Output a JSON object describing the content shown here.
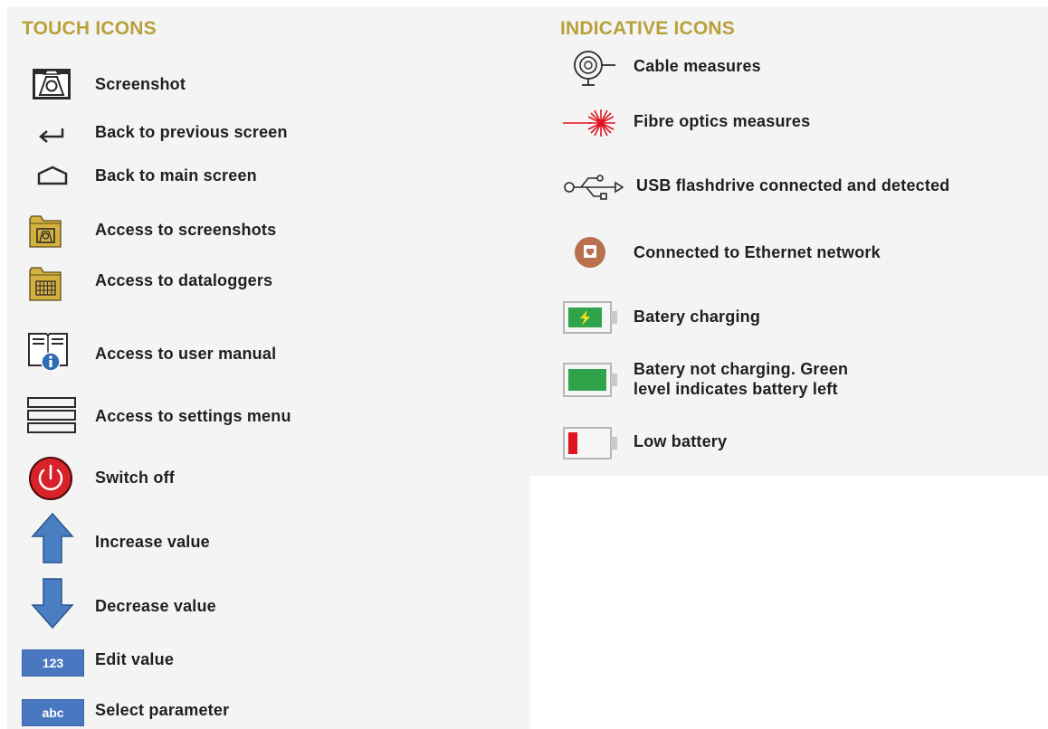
{
  "touch": {
    "heading": "TOUCH ICONS",
    "items": [
      {
        "label": "Screenshot",
        "icon": "camera-icon"
      },
      {
        "label": "Back to previous screen",
        "icon": "return-arrow-icon"
      },
      {
        "label": "Back to main screen",
        "icon": "home-icon"
      },
      {
        "label": "Access to screenshots",
        "icon": "screenshots-folder-icon"
      },
      {
        "label": "Access to dataloggers",
        "icon": "datalogger-folder-icon"
      },
      {
        "label": "Access to user manual",
        "icon": "user-manual-icon"
      },
      {
        "label": "Access to settings menu",
        "icon": "menu-icon"
      },
      {
        "label": "Switch off",
        "icon": "power-icon"
      },
      {
        "label": "Increase value",
        "icon": "arrow-up-icon"
      },
      {
        "label": "Decrease value",
        "icon": "arrow-down-icon"
      },
      {
        "label": "Edit value",
        "icon": "edit-value-icon",
        "icon_text": "123"
      },
      {
        "label": "Select parameter",
        "icon": "select-parameter-icon",
        "icon_text": "abc"
      }
    ]
  },
  "indicative": {
    "heading": "INDICATIVE ICONS",
    "items": [
      {
        "label": "Cable measures",
        "icon": "cable-icon"
      },
      {
        "label": "Fibre optics measures",
        "icon": "laser-icon"
      },
      {
        "label": "USB flashdrive connected and detected",
        "icon": "usb-icon"
      },
      {
        "label": "Connected to Ethernet network",
        "icon": "ethernet-icon"
      },
      {
        "label": "Batery charging",
        "icon": "battery-charging-icon"
      },
      {
        "label_line1": "Batery not charging. Green",
        "label_line2": "level indicates battery left",
        "icon": "battery-full-icon"
      },
      {
        "label": "Low battery",
        "icon": "battery-low-icon"
      }
    ]
  },
  "colors": {
    "heading": "#b9a13a",
    "folder": "#d4b13f",
    "blue_button": "#4a78c0",
    "power_red": "#d8222a",
    "ethernet_brown": "#b8704e",
    "battery_green": "#2ea34a",
    "battery_red": "#e0141e",
    "laser_red": "#e0141e"
  }
}
